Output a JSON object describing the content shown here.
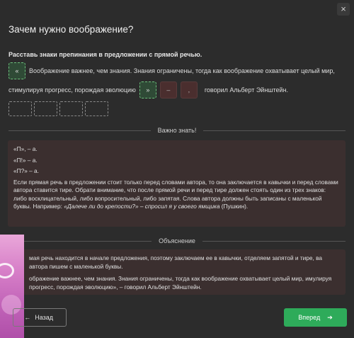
{
  "window": {
    "close_symbol": "×"
  },
  "page": {
    "title": "Зачем нужно воображение?"
  },
  "task": {
    "instruction": "Расставь знаки препинания в предложении с прямой речью.",
    "slot1": "«",
    "line1_text": "Воображение важнее, чем знания. Знания ограничены, тогда как воображение охватывает целый мир,",
    "line2_text": "стимулируя прогресс, порождая эволюцию",
    "slot2": "»",
    "slot3": "–",
    "slot4": ",",
    "line2_end": "говорил Альберт Эйнштейн."
  },
  "important": {
    "header": "Важно знать!",
    "examples": [
      "«П», – а.",
      "«П!» – а.",
      "«П?» – а."
    ],
    "rule_text": "Если прямая речь в предложении стоит только перед словами автора, то она заключается в кавычки и перед словами автора ставится тире. Обрати внимание, что после прямой речи и перед тире должен стоять один из трех знаков: либо восклицательный, либо вопросительный, либо запятая. Слова автора должны быть записаны с маленькой буквы. Например: ",
    "rule_example": "«Далече ли до крепости?» – спросил я у своего ямщика",
    "rule_end": " (Пушкин)."
  },
  "explanation": {
    "header": "Объяснение",
    "para1": "мая речь находится в начале предложения, поэтому заключаем ее в кавычки, отделяем запятой и тире, ва автора пишем с маленькой буквы.",
    "para2": "ображение важнее, чем знания. Знания ограничены, тогда как воображение охватывает целый мир, имулируя прогресс, порождая эволюцию», – говорил Альберт Эйнштейн."
  },
  "nav": {
    "back_label": "Назад",
    "next_label": "Вперед"
  },
  "colors": {
    "accent": "#2eab5a",
    "info_bg": "#3b2f2f"
  }
}
